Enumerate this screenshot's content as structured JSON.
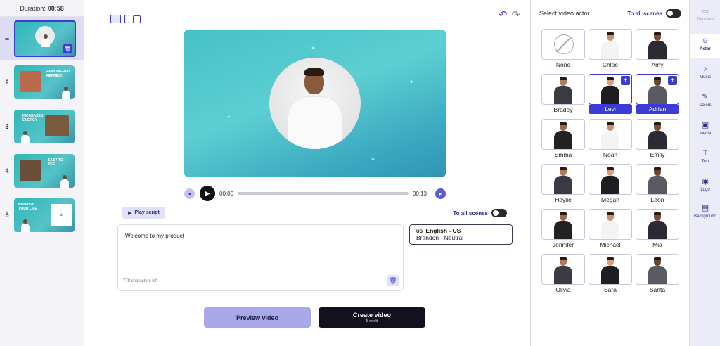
{
  "duration": {
    "label": "Duration:",
    "value": "00:58"
  },
  "scenes": [
    {
      "num": "",
      "title": ""
    },
    {
      "num": "2",
      "title": "EMPOWERED REFRESH"
    },
    {
      "num": "3",
      "title": "INCREASED ENERGY"
    },
    {
      "num": "4",
      "title": "EASY TO USE"
    },
    {
      "num": "5",
      "title": "NOURISH YOUR LIFE"
    }
  ],
  "player": {
    "current_time": "00:00",
    "total_time": "00:13",
    "progress": 0
  },
  "script": {
    "play_label": "Play script",
    "text": "Welcome to my product",
    "chars_left": "778 characters left",
    "to_all_scenes": "To all scenes"
  },
  "voice": {
    "flag": "US",
    "language": "English - US",
    "voice_name": "Brandon - Neutral"
  },
  "buttons": {
    "preview": "Preview video",
    "create": "Create video",
    "create_sub": "5 credit"
  },
  "actor_panel": {
    "heading": "Select video actor",
    "to_all_scenes": "To all scenes",
    "actors": [
      {
        "name": "None",
        "selected": false
      },
      {
        "name": "Chloe",
        "selected": false
      },
      {
        "name": "Amy",
        "selected": false
      },
      {
        "name": "Bradey",
        "selected": false
      },
      {
        "name": "Levi",
        "selected": true
      },
      {
        "name": "Adrian",
        "selected": true
      },
      {
        "name": "Emma",
        "selected": false
      },
      {
        "name": "Noah",
        "selected": false
      },
      {
        "name": "Emily",
        "selected": false
      },
      {
        "name": "Haylie",
        "selected": false
      },
      {
        "name": "Megan",
        "selected": false
      },
      {
        "name": "Leon",
        "selected": false
      },
      {
        "name": "Jennifer",
        "selected": false
      },
      {
        "name": "Michael",
        "selected": false
      },
      {
        "name": "Mia",
        "selected": false
      },
      {
        "name": "Olivia",
        "selected": false
      },
      {
        "name": "Sara",
        "selected": false
      },
      {
        "name": "Santa",
        "selected": false
      }
    ]
  },
  "toolbar": [
    {
      "label": "Template",
      "icon": "template-icon",
      "state": "dim"
    },
    {
      "label": "Actor",
      "icon": "actor-icon",
      "state": "active"
    },
    {
      "label": "Music",
      "icon": "music-icon",
      "state": "normal"
    },
    {
      "label": "Colors",
      "icon": "colors-icon",
      "state": "normal"
    },
    {
      "label": "Media",
      "icon": "media-icon",
      "state": "normal"
    },
    {
      "label": "Text",
      "icon": "text-icon",
      "state": "normal"
    },
    {
      "label": "Logo",
      "icon": "logo-icon",
      "state": "normal"
    },
    {
      "label": "Background",
      "icon": "background-icon",
      "state": "normal"
    }
  ],
  "colors": {
    "accent": "#3b3bd6",
    "preview_bg": "#46c1c6",
    "create_bg": "#14111f",
    "preview_btn_bg": "#a9a9ea"
  }
}
